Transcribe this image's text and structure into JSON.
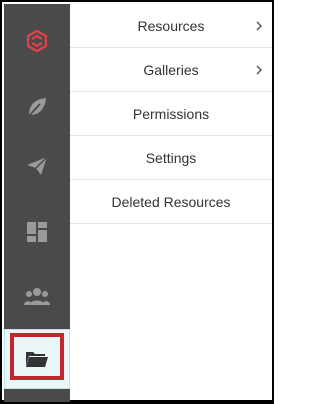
{
  "rail": {
    "items": [
      {
        "icon": "logo-icon",
        "color": "#e0414b"
      },
      {
        "icon": "leaf-icon",
        "color": "#9a9a9a"
      },
      {
        "icon": "send-icon",
        "color": "#9a9a9a"
      },
      {
        "icon": "dashboard-icon",
        "color": "#9a9a9a"
      },
      {
        "icon": "users-icon",
        "color": "#9a9a9a"
      },
      {
        "icon": "folder-icon",
        "color": "#333333",
        "active": true
      }
    ],
    "highlight_color": "#c1272d"
  },
  "menu": {
    "items": [
      {
        "label": "Resources",
        "has_submenu": true
      },
      {
        "label": "Galleries",
        "has_submenu": true
      },
      {
        "label": "Permissions",
        "has_submenu": false
      },
      {
        "label": "Settings",
        "has_submenu": false
      },
      {
        "label": "Deleted Resources",
        "has_submenu": false
      }
    ]
  }
}
